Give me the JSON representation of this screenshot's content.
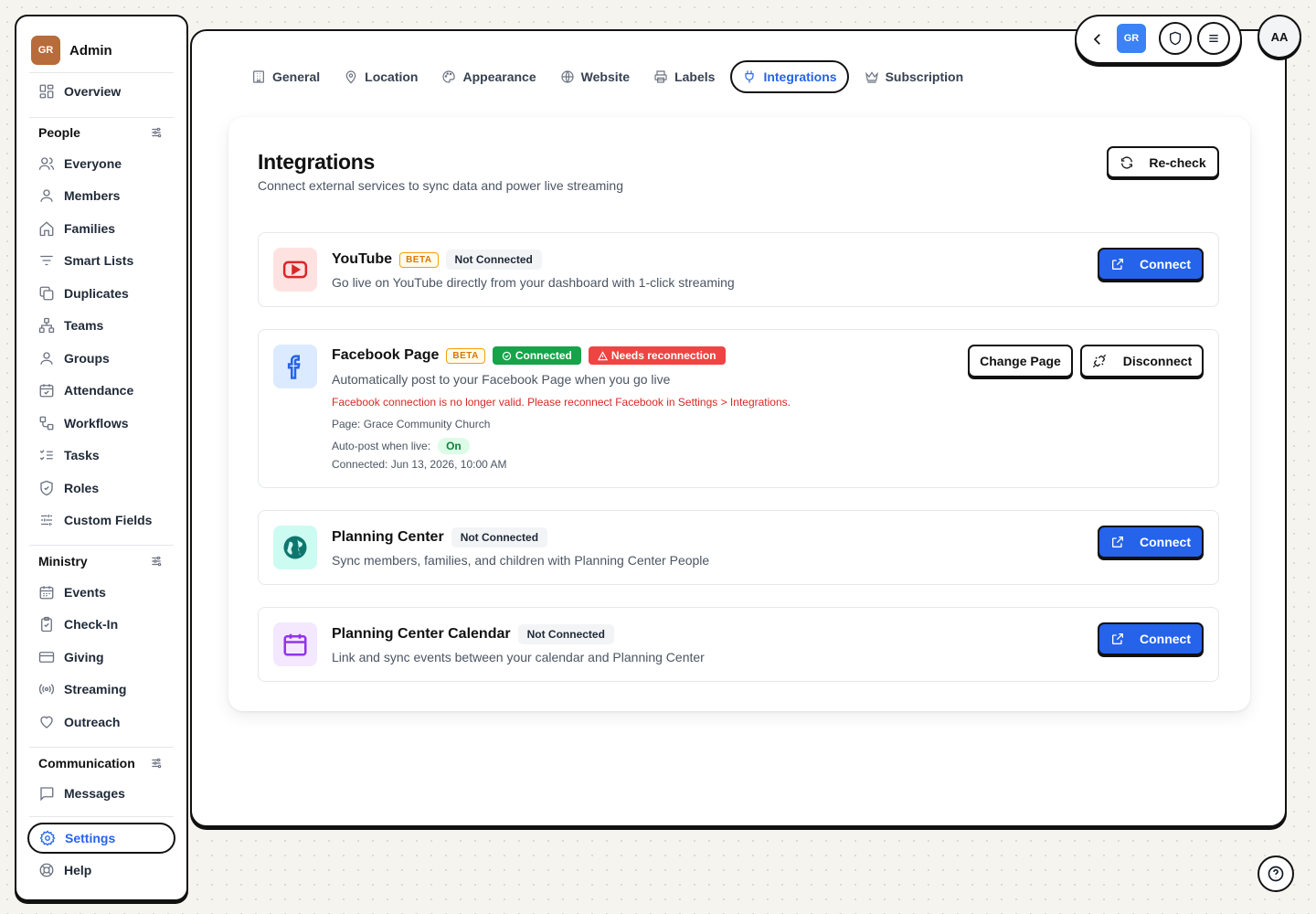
{
  "sidebar": {
    "org_initials": "GR",
    "org_name": "Admin",
    "overview": "Overview",
    "people": {
      "title": "People",
      "items": [
        "Everyone",
        "Members",
        "Families",
        "Smart Lists",
        "Duplicates",
        "Teams",
        "Groups",
        "Attendance",
        "Workflows",
        "Tasks",
        "Roles",
        "Custom Fields"
      ]
    },
    "ministry": {
      "title": "Ministry",
      "items": [
        "Events",
        "Check-In",
        "Giving",
        "Streaming",
        "Outreach"
      ]
    },
    "communication": {
      "title": "Communication",
      "items": [
        "Messages"
      ]
    },
    "settings": "Settings",
    "help": "Help"
  },
  "tabs": [
    {
      "label": "General",
      "icon": "building-icon"
    },
    {
      "label": "Location",
      "icon": "map-pin-icon"
    },
    {
      "label": "Appearance",
      "icon": "palette-icon"
    },
    {
      "label": "Website",
      "icon": "globe-icon"
    },
    {
      "label": "Labels",
      "icon": "printer-icon"
    },
    {
      "label": "Integrations",
      "icon": "plug-icon",
      "active": true
    },
    {
      "label": "Subscription",
      "icon": "crown-icon"
    }
  ],
  "page": {
    "title": "Integrations",
    "subtitle": "Connect external services to sync data and power live streaming",
    "recheck_label": "Re-check"
  },
  "integrations": {
    "youtube": {
      "name": "YouTube",
      "beta": "BETA",
      "status": "Not Connected",
      "description": "Go live on YouTube directly from your dashboard with 1-click streaming",
      "button": "Connect"
    },
    "facebook": {
      "name": "Facebook Page",
      "beta": "BETA",
      "status": "Connected",
      "warning": "Needs reconnection",
      "description": "Automatically post to your Facebook Page when you go live",
      "error": "Facebook connection is no longer valid. Please reconnect Facebook in Settings > Integrations.",
      "page_line": "Page: Grace Community Church",
      "autopost_label": "Auto-post when live:",
      "autopost_value": "On",
      "connected_line": "Connected: Jun 13, 2026, 10:00 AM",
      "change_button": "Change Page",
      "disconnect_button": "Disconnect"
    },
    "planning_center": {
      "name": "Planning Center",
      "status": "Not Connected",
      "description": "Sync members, families, and children with Planning Center People",
      "button": "Connect"
    },
    "pc_calendar": {
      "name": "Planning Center Calendar",
      "status": "Not Connected",
      "description": "Link and sync events between your calendar and Planning Center",
      "button": "Connect"
    }
  },
  "topbar": {
    "org_initials": "GR",
    "avatar_initials": "AA"
  },
  "colors": {
    "primary": "#2563eb",
    "success": "#16a34a",
    "danger": "#ef4444",
    "beta": "#d97706"
  }
}
